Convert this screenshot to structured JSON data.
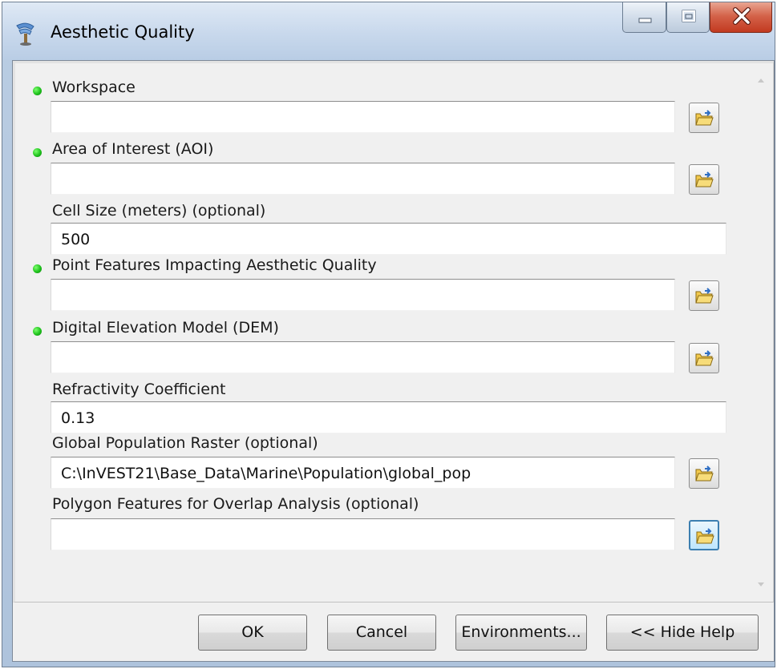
{
  "window": {
    "title": "Aesthetic Quality",
    "controls": [
      "minimize-icon",
      "maximize-icon",
      "close-icon"
    ]
  },
  "colors": {
    "required_dot": "#1fc21d",
    "title_bar": "#c8d8ec",
    "close_button": "#d4634a"
  },
  "fields": [
    {
      "label": "Workspace",
      "required": true,
      "value": "",
      "browse": true
    },
    {
      "label": "Area of Interest (AOI)",
      "required": true,
      "value": "",
      "browse": true
    },
    {
      "label": "Cell Size (meters) (optional)",
      "required": false,
      "value": "500",
      "browse": false
    },
    {
      "label": "Point Features Impacting Aesthetic Quality",
      "required": true,
      "value": "",
      "browse": true
    },
    {
      "label": "Digital Elevation Model (DEM)",
      "required": true,
      "value": "",
      "browse": true
    },
    {
      "label": "Refractivity Coefficient",
      "required": false,
      "value": "0.13",
      "browse": false
    },
    {
      "label": "Global Population Raster (optional)",
      "required": false,
      "value": "C:\\InVEST21\\Base_Data\\Marine\\Population\\global_pop",
      "browse": true
    },
    {
      "label": "Polygon Features for Overlap Analysis (optional)",
      "required": false,
      "value": "",
      "browse": true
    }
  ],
  "buttons": {
    "ok": "OK",
    "cancel": "Cancel",
    "environments": "Environments...",
    "hide_help": "<< Hide Help"
  }
}
